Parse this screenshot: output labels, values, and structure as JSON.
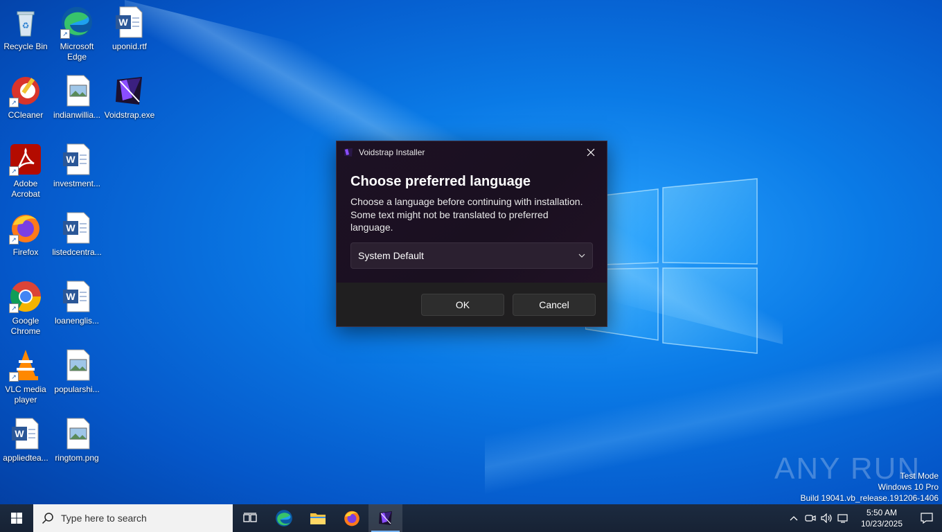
{
  "desktop": {
    "icons": [
      {
        "label": "Recycle Bin"
      },
      {
        "label": "Microsoft Edge"
      },
      {
        "label": "uponid.rtf"
      },
      {
        "label": "CCleaner"
      },
      {
        "label": "indianwillia..."
      },
      {
        "label": "Voidstrap.exe"
      },
      {
        "label": "Adobe Acrobat"
      },
      {
        "label": "investment..."
      },
      {
        "label": "Firefox"
      },
      {
        "label": "listedcentra..."
      },
      {
        "label": "Google Chrome"
      },
      {
        "label": "loanenglis..."
      },
      {
        "label": "VLC media player"
      },
      {
        "label": "popularshi..."
      },
      {
        "label": "appliedtea..."
      },
      {
        "label": "ringtom.png"
      }
    ]
  },
  "dialog": {
    "title": "Voidstrap Installer",
    "heading": "Choose preferred language",
    "description": "Choose a language before continuing with installation. Some text might not be translated to preferred language.",
    "language_selected": "System Default",
    "ok_label": "OK",
    "cancel_label": "Cancel"
  },
  "watermark": {
    "brand": "ANY RUN",
    "test_mode": "Test Mode",
    "edition": "Windows 10 Pro",
    "build": "Build 19041.vb_release.191206-1406"
  },
  "taskbar": {
    "search_placeholder": "Type here to search",
    "time": "5:50 AM",
    "date": "10/23/2025"
  },
  "colors": {
    "desktop_blue": "#0a7ae6",
    "dialog_bg": "#1a1020",
    "accent_purple": "#7b3fe4"
  }
}
